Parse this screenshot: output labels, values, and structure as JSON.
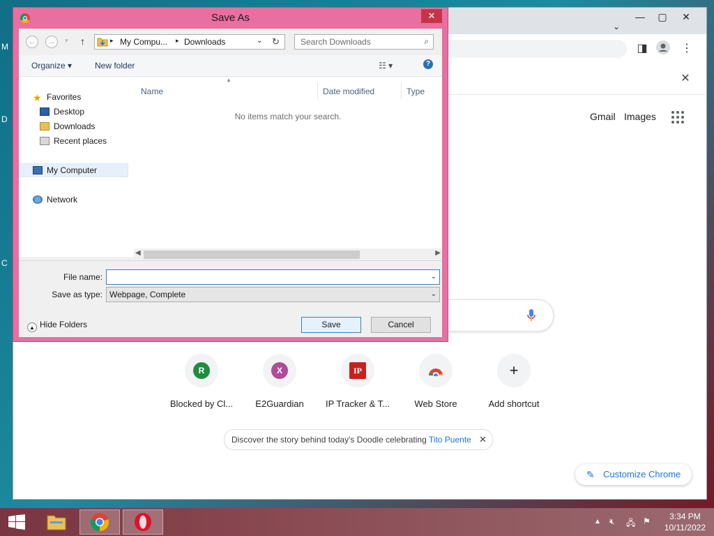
{
  "dialog": {
    "title": "Save As",
    "close_label": "✕",
    "breadcrumb": [
      "My Compu...",
      "Downloads"
    ],
    "search_placeholder": "Search Downloads",
    "organize_label": "Organize ▾",
    "new_folder_label": "New folder",
    "nav": {
      "favorites": "Favorites",
      "desktop": "Desktop",
      "downloads": "Downloads",
      "recent": "Recent places",
      "my_computer": "My Computer",
      "network": "Network"
    },
    "columns": [
      "Name",
      "Date modified",
      "Type"
    ],
    "empty_message": "No items match your search.",
    "file_name_label": "File name:",
    "file_name_value": "",
    "save_type_label": "Save as type:",
    "save_type_value": "Webpage, Complete",
    "save_label": "Save",
    "cancel_label": "Cancel",
    "hide_folders_label": "Hide Folders"
  },
  "chrome": {
    "links": {
      "gmail": "Gmail",
      "images": "Images"
    },
    "shortcuts": [
      {
        "label": "Blocked by Cl...",
        "initial": "R",
        "color": "#1e8e3e"
      },
      {
        "label": "E2Guardian",
        "initial": "X",
        "color": "#b04a9a"
      },
      {
        "label": "IP Tracker & T...",
        "initial": "IP",
        "color": "#c5221f"
      },
      {
        "label": "Web Store",
        "initial": "",
        "color": "#f1f3f4"
      },
      {
        "label": "Add shortcut",
        "initial": "+",
        "color": "#f1f3f4"
      }
    ],
    "doodle_text": "Discover the story behind today's Doodle celebrating",
    "doodle_link": "Tito Puente",
    "customize_label": "Customize Chrome"
  },
  "taskbar": {
    "time": "3:34 PM",
    "date": "10/11/2022"
  },
  "desktop_letters": [
    "M",
    "D",
    "C"
  ]
}
